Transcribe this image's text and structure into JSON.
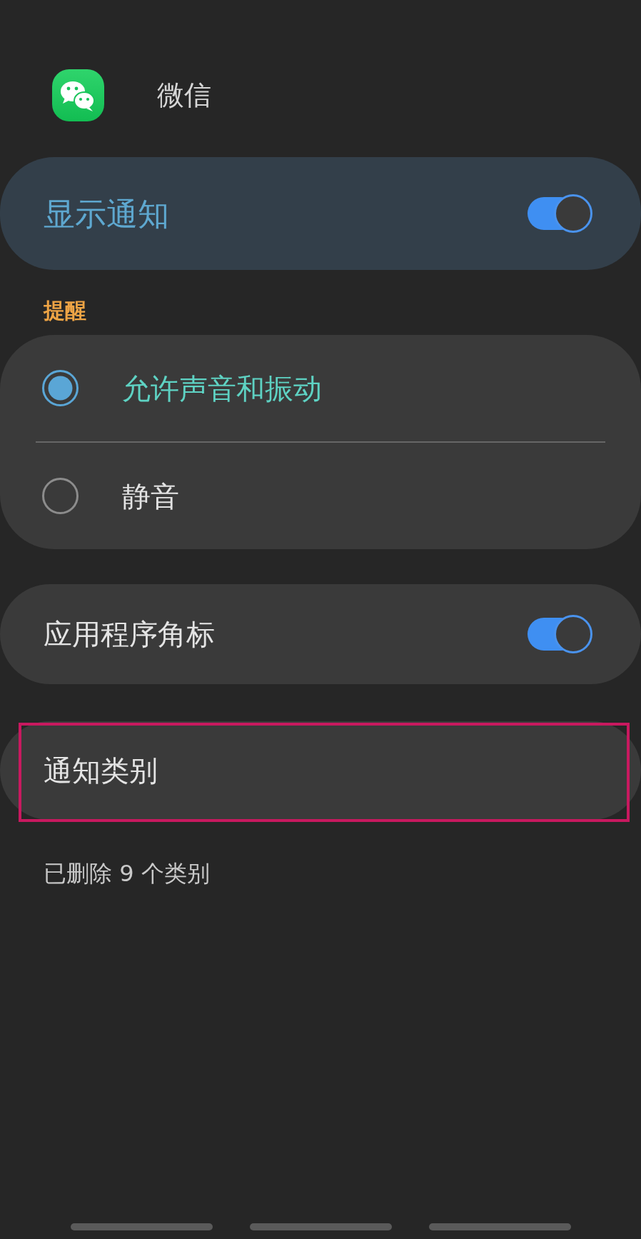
{
  "app": {
    "name": "微信"
  },
  "master_switch": {
    "label": "显示通知",
    "on": true
  },
  "alert_section": {
    "title": "提醒",
    "options": [
      {
        "label": "允许声音和振动",
        "selected": true
      },
      {
        "label": "静音",
        "selected": false
      }
    ]
  },
  "badge_setting": {
    "label": "应用程序角标",
    "on": true
  },
  "category_row": {
    "label": "通知类别",
    "highlighted": true
  },
  "deleted_note": "已删除 9 个类别"
}
